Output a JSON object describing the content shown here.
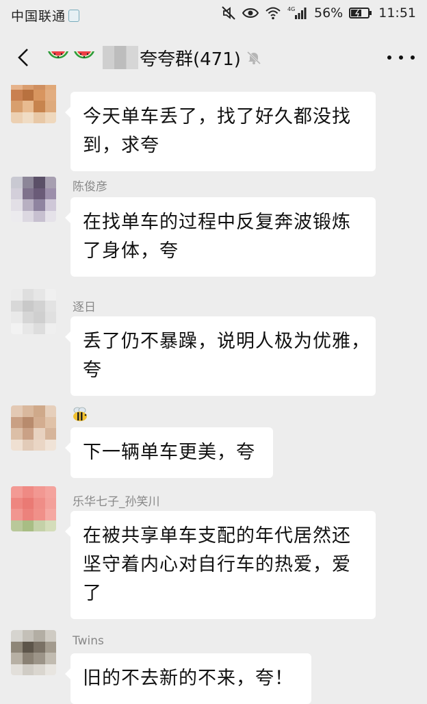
{
  "status_bar": {
    "carrier": "中国联通",
    "signal_type": "4G",
    "battery_percent": "56%",
    "time": "11:51"
  },
  "header": {
    "title": "夸夸群(471)",
    "emoji_icons": [
      "watermelon-icon",
      "watermelon-icon"
    ],
    "muted": true
  },
  "messages": [
    {
      "sender": "",
      "lines": [
        "今天单车丢了，找了好久都没找",
        "到，求夸"
      ]
    },
    {
      "sender": "陈俊彦",
      "lines": [
        "在找单车的过程中反复奔波锻炼",
        "了身体，夸"
      ]
    },
    {
      "sender": "逐日",
      "lines": [
        "丢了仍不暴躁，说明人极为优雅，",
        "夸"
      ]
    },
    {
      "sender": "",
      "sender_icon": "bee-icon",
      "lines": [
        "下一辆单车更美，夸"
      ]
    },
    {
      "sender": "乐华七子_孙笑川",
      "lines": [
        "在被共享单车支配的年代居然还",
        "坚守着内心对自行车的热爱，爱",
        "了"
      ]
    },
    {
      "sender": "Twins",
      "lines": [
        "旧的不去新的不来，夸！"
      ]
    }
  ]
}
